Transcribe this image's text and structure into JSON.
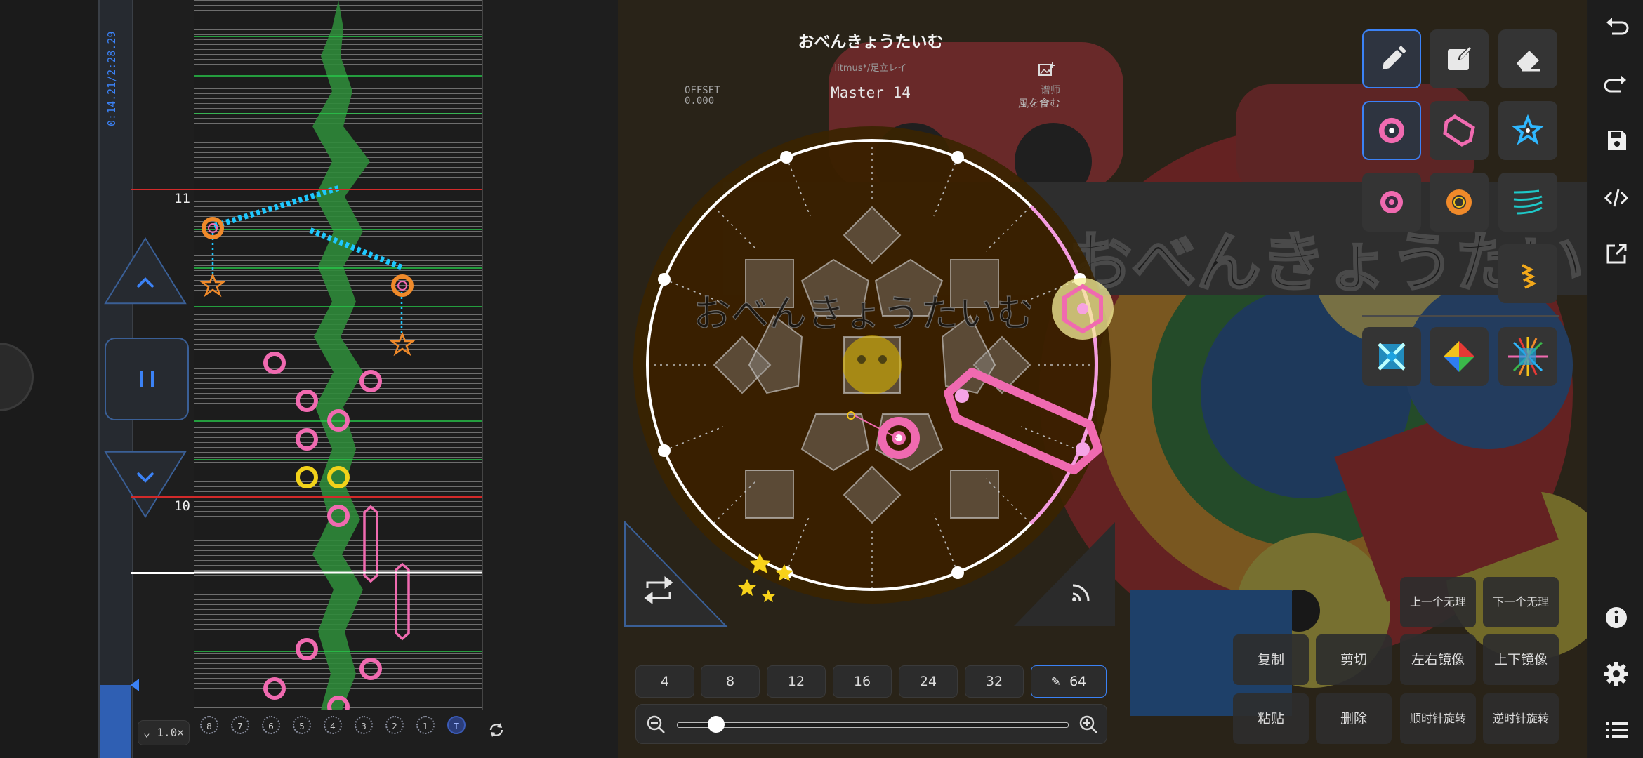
{
  "song": {
    "title": "おべんきょうたいむ",
    "artist": "litmus*/足立レイ",
    "offset_label": "OFFSET",
    "offset_value": "0.000",
    "difficulty": "Master 14",
    "designer_label": "谱师",
    "designer_name": "風を食む",
    "bg_text": "おべんきょうたいむ"
  },
  "timeline": {
    "time_current": "0:14.21",
    "time_sep": "/",
    "time_total": "2:28.29",
    "progress": 0.096,
    "measure_labels": [
      "11",
      "10"
    ],
    "speed": "1.0×",
    "lanes": [
      "8",
      "7",
      "6",
      "5",
      "4",
      "3",
      "2",
      "1",
      "T"
    ]
  },
  "beats": {
    "options": [
      "4",
      "8",
      "12",
      "16",
      "24",
      "32",
      "64"
    ],
    "selected": "64"
  },
  "zoom": {
    "level": 0.1
  },
  "actions": {
    "prev_nonsense": "上一个无理",
    "next_nonsense": "下一个无理",
    "copy": "复制",
    "cut": "剪切",
    "mirror_lr": "左右镜像",
    "mirror_ud": "上下镜像",
    "paste": "粘贴",
    "delete": "删除",
    "rotate_cw": "顺时针旋转",
    "rotate_ccw": "逆时针旋转"
  },
  "colors": {
    "accent": "#3b82f6",
    "tap_note": "#f06ab0",
    "break_note": "#f2c21a",
    "slide_arrow": "#1ec8ff",
    "ring": "#ffffff",
    "measure_line": "#d22a2a",
    "waveform": "#2f8a3a"
  },
  "icons": {
    "left_nav": [
      "chevron-up-icon",
      "pause-icon",
      "chevron-down-icon"
    ],
    "tools": [
      "pencil-icon",
      "edit-box-icon",
      "eraser-icon",
      "tap-note-icon",
      "hold-note-icon",
      "star-note-icon",
      "touch-note-icon",
      "break-note-icon",
      "slide-icon",
      "slide-alt-icon",
      "touch-x-icon",
      "color-diamond-icon",
      "firework-icon"
    ],
    "rail": [
      "undo-icon",
      "redo-icon",
      "save-icon",
      "code-icon",
      "export-icon",
      "info-icon",
      "settings-icon",
      "list-icon"
    ]
  }
}
